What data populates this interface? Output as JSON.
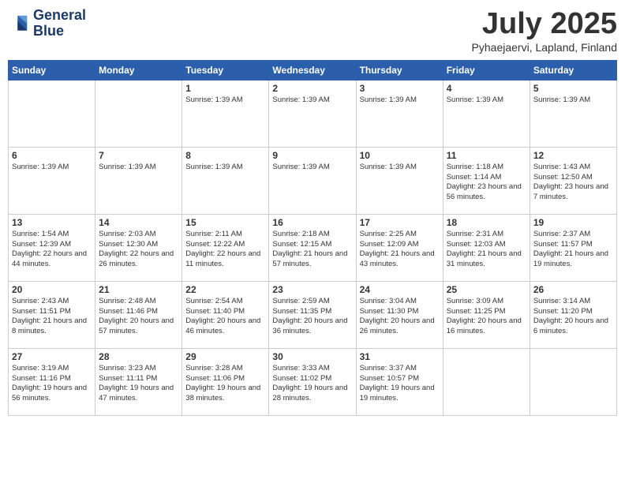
{
  "header": {
    "logo_line1": "General",
    "logo_line2": "Blue",
    "month": "July 2025",
    "location": "Pyhaejaervi, Lapland, Finland"
  },
  "weekdays": [
    "Sunday",
    "Monday",
    "Tuesday",
    "Wednesday",
    "Thursday",
    "Friday",
    "Saturday"
  ],
  "weeks": [
    [
      {
        "day": "",
        "text": ""
      },
      {
        "day": "",
        "text": ""
      },
      {
        "day": "1",
        "text": "Sunrise: 1:39 AM"
      },
      {
        "day": "2",
        "text": "Sunrise: 1:39 AM"
      },
      {
        "day": "3",
        "text": "Sunrise: 1:39 AM"
      },
      {
        "day": "4",
        "text": "Sunrise: 1:39 AM"
      },
      {
        "day": "5",
        "text": "Sunrise: 1:39 AM"
      }
    ],
    [
      {
        "day": "6",
        "text": "Sunrise: 1:39 AM"
      },
      {
        "day": "7",
        "text": "Sunrise: 1:39 AM"
      },
      {
        "day": "8",
        "text": "Sunrise: 1:39 AM"
      },
      {
        "day": "9",
        "text": "Sunrise: 1:39 AM"
      },
      {
        "day": "10",
        "text": "Sunrise: 1:39 AM"
      },
      {
        "day": "11",
        "text": "Sunrise: 1:18 AM\nSunset: 1:14 AM\nDaylight: 23 hours and 56 minutes."
      },
      {
        "day": "12",
        "text": "Sunrise: 1:43 AM\nSunset: 12:50 AM\nDaylight: 23 hours and 7 minutes."
      }
    ],
    [
      {
        "day": "13",
        "text": "Sunrise: 1:54 AM\nSunset: 12:39 AM\nDaylight: 22 hours and 44 minutes."
      },
      {
        "day": "14",
        "text": "Sunrise: 2:03 AM\nSunset: 12:30 AM\nDaylight: 22 hours and 26 minutes."
      },
      {
        "day": "15",
        "text": "Sunrise: 2:11 AM\nSunset: 12:22 AM\nDaylight: 22 hours and 11 minutes."
      },
      {
        "day": "16",
        "text": "Sunrise: 2:18 AM\nSunset: 12:15 AM\nDaylight: 21 hours and 57 minutes."
      },
      {
        "day": "17",
        "text": "Sunrise: 2:25 AM\nSunset: 12:09 AM\nDaylight: 21 hours and 43 minutes."
      },
      {
        "day": "18",
        "text": "Sunrise: 2:31 AM\nSunset: 12:03 AM\nDaylight: 21 hours and 31 minutes."
      },
      {
        "day": "19",
        "text": "Sunrise: 2:37 AM\nSunset: 11:57 PM\nDaylight: 21 hours and 19 minutes."
      }
    ],
    [
      {
        "day": "20",
        "text": "Sunrise: 2:43 AM\nSunset: 11:51 PM\nDaylight: 21 hours and 8 minutes."
      },
      {
        "day": "21",
        "text": "Sunrise: 2:48 AM\nSunset: 11:46 PM\nDaylight: 20 hours and 57 minutes."
      },
      {
        "day": "22",
        "text": "Sunrise: 2:54 AM\nSunset: 11:40 PM\nDaylight: 20 hours and 46 minutes."
      },
      {
        "day": "23",
        "text": "Sunrise: 2:59 AM\nSunset: 11:35 PM\nDaylight: 20 hours and 36 minutes."
      },
      {
        "day": "24",
        "text": "Sunrise: 3:04 AM\nSunset: 11:30 PM\nDaylight: 20 hours and 26 minutes."
      },
      {
        "day": "25",
        "text": "Sunrise: 3:09 AM\nSunset: 11:25 PM\nDaylight: 20 hours and 16 minutes."
      },
      {
        "day": "26",
        "text": "Sunrise: 3:14 AM\nSunset: 11:20 PM\nDaylight: 20 hours and 6 minutes."
      }
    ],
    [
      {
        "day": "27",
        "text": "Sunrise: 3:19 AM\nSunset: 11:16 PM\nDaylight: 19 hours and 56 minutes."
      },
      {
        "day": "28",
        "text": "Sunrise: 3:23 AM\nSunset: 11:11 PM\nDaylight: 19 hours and 47 minutes."
      },
      {
        "day": "29",
        "text": "Sunrise: 3:28 AM\nSunset: 11:06 PM\nDaylight: 19 hours and 38 minutes."
      },
      {
        "day": "30",
        "text": "Sunrise: 3:33 AM\nSunset: 11:02 PM\nDaylight: 19 hours and 28 minutes."
      },
      {
        "day": "31",
        "text": "Sunrise: 3:37 AM\nSunset: 10:57 PM\nDaylight: 19 hours and 19 minutes."
      },
      {
        "day": "",
        "text": ""
      },
      {
        "day": "",
        "text": ""
      }
    ]
  ]
}
